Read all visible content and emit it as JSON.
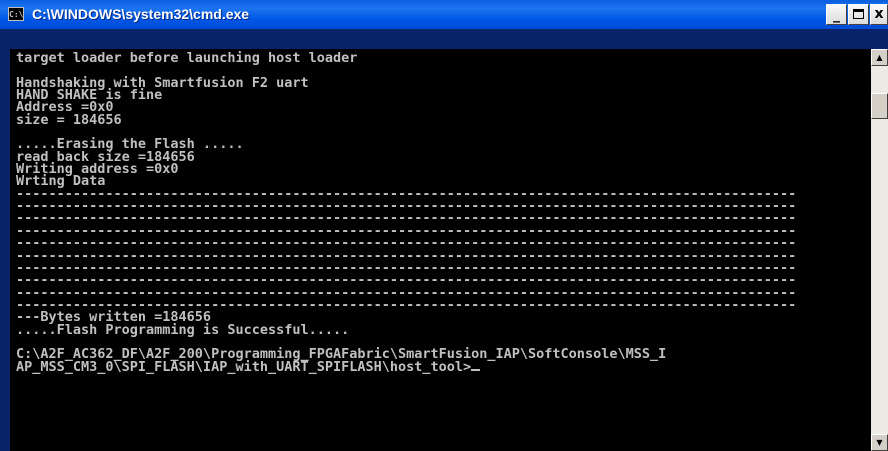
{
  "window": {
    "title": "C:\\WINDOWS\\system32\\cmd.exe",
    "icon": "cmd-icon",
    "minimize_label": "_",
    "close_label": "x"
  },
  "console": {
    "lines": [
      "target loader before launching host loader",
      "",
      "Handshaking with Smartfusion F2 uart",
      "HAND SHAKE is fine",
      "Address =0x0",
      "size = 184656",
      "",
      ".....Erasing the Flash .....",
      "read back size =184656",
      "Writing address =0x0",
      "Wrting Data",
      "------------------------------------------------------------------------------------------------",
      "------------------------------------------------------------------------------------------------",
      "------------------------------------------------------------------------------------------------",
      "------------------------------------------------------------------------------------------------",
      "------------------------------------------------------------------------------------------------",
      "------------------------------------------------------------------------------------------------",
      "------------------------------------------------------------------------------------------------",
      "------------------------------------------------------------------------------------------------",
      "------------------------------------------------------------------------------------------------",
      "------------------------------------------------------------------------------------------------",
      "---Bytes written =184656",
      ".....Flash Programming is Successful.....",
      "",
      "C:\\A2F_AC362_DF\\A2F_200\\Programming_FPGAFabric\\SmartFusion_IAP\\SoftConsole\\MSS_I",
      "AP_MSS_CM3_0\\SPI_FLASH\\IAP_with_UART_SPIFLASH\\host_tool>"
    ]
  },
  "scrollbar": {
    "up_icon": "scroll-up-arrow-icon",
    "down_icon": "scroll-down-arrow-icon"
  }
}
